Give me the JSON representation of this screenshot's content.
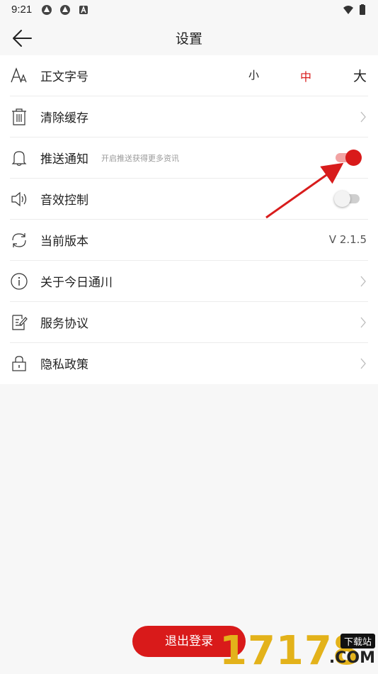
{
  "status_bar": {
    "time": "9:21"
  },
  "header": {
    "title": "设置"
  },
  "settings": {
    "font_size": {
      "label": "正文字号",
      "options": [
        "小",
        "中",
        "大"
      ],
      "selected": "中"
    },
    "clear_cache": {
      "label": "清除缓存"
    },
    "push": {
      "label": "推送通知",
      "description": "开启推送获得更多资讯",
      "enabled": true
    },
    "sound": {
      "label": "音效控制",
      "enabled": false
    },
    "version": {
      "label": "当前版本",
      "value": "V 2.1.5"
    },
    "about": {
      "label": "关于今日通川"
    },
    "service": {
      "label": "服务协议"
    },
    "privacy": {
      "label": "隐私政策"
    }
  },
  "logout": {
    "label": "退出登录"
  },
  "watermark": {
    "digits": "17178",
    "badge": "下载站",
    "domain": ".COM"
  },
  "colors": {
    "accent": "#d91a1a",
    "toggle_on_track": "#f2a3a3",
    "toggle_off_track": "#cfcfcf"
  }
}
